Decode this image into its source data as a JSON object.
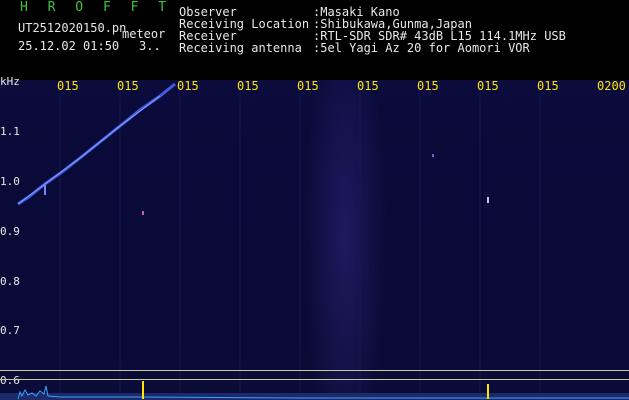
{
  "header": {
    "logo": "H R O F F T",
    "filename": "UT2512020150.pn",
    "meteor_label": "meteor",
    "datetime": "25.12.02 01:50",
    "count": "3..",
    "fields": [
      {
        "label": "Observer",
        "value": ":Masaki Kano"
      },
      {
        "label": "Receiving Location",
        "value": ":Shibukawa,Gunma,Japan"
      },
      {
        "label": "Receiver",
        "value": ":RTL-SDR SDR# 43dB L15 114.1MHz USB"
      },
      {
        "label": "Receiving antenna",
        "value": ":5el Yagi Az 20 for Aomori VOR"
      }
    ]
  },
  "y_axis": {
    "unit": "kHz",
    "ticks": [
      "1.1",
      "1.0",
      "0.9",
      "0.8",
      "0.7",
      "0.6"
    ]
  },
  "x_axis": {
    "ticks": [
      "015",
      "015",
      "015",
      "015",
      "015",
      "015",
      "015",
      "015",
      "015",
      "0200"
    ]
  },
  "colors": {
    "background": "#000000",
    "spectrogram": "#0a0a36",
    "logo": "#3cc43c",
    "time_ticks": "#ffe600",
    "trace": "#4a6aff",
    "marker": "#ffe600"
  }
}
